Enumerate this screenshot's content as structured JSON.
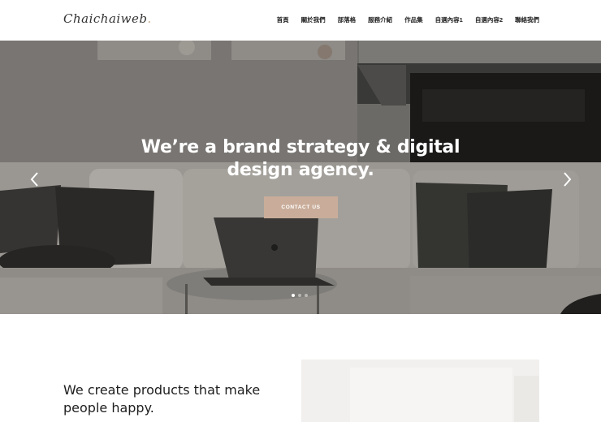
{
  "header": {
    "logo_text": "Chaichaiweb",
    "logo_dot": ".",
    "nav": [
      "首頁",
      "關於我們",
      "部落格",
      "服務介紹",
      "作品集",
      "自選內容1",
      "自選內容2",
      "聯絡我們"
    ]
  },
  "hero": {
    "title_line1": "We’re a brand strategy & digital",
    "title_line2": "design agency.",
    "cta_label": "CONTACT US",
    "slides_count": 3,
    "active_slide": 1
  },
  "intro": {
    "heading": "We create products that make people happy."
  },
  "colors": {
    "accent": "#c9ad9a",
    "text": "#222222"
  },
  "icons": [
    "chevron-left-icon",
    "chevron-right-icon"
  ]
}
